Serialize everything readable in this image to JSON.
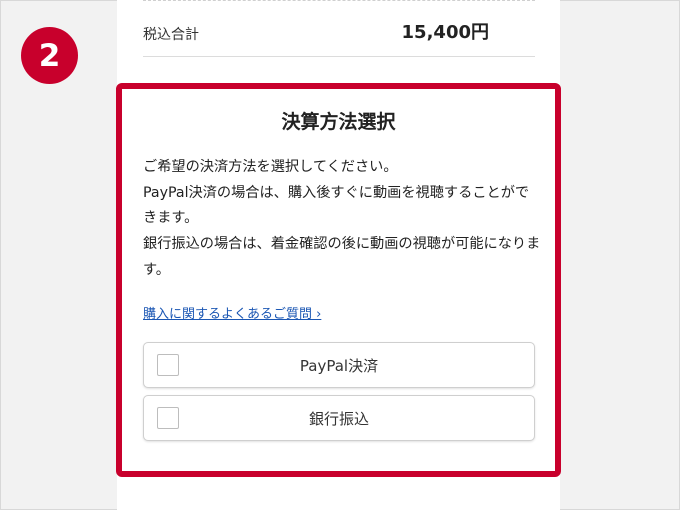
{
  "step": {
    "number": "2"
  },
  "order": {
    "total_label": "税込合計",
    "total_value": "15,400円"
  },
  "payment": {
    "title": "決算方法選択",
    "description": [
      "ご希望の決済方法を選択してください。",
      "PayPal決済の場合は、購入後すぐに動画を視聴することができます。",
      "銀行振込の場合は、着金確認の後に動画の視聴が可能になります。"
    ],
    "faq_link": "購入に関するよくあるご質問 ›",
    "options": [
      {
        "label": "PayPal決済",
        "checked": false
      },
      {
        "label": "銀行振込",
        "checked": false
      }
    ]
  },
  "colors": {
    "accent": "#c8002c",
    "link": "#1a56b3"
  }
}
